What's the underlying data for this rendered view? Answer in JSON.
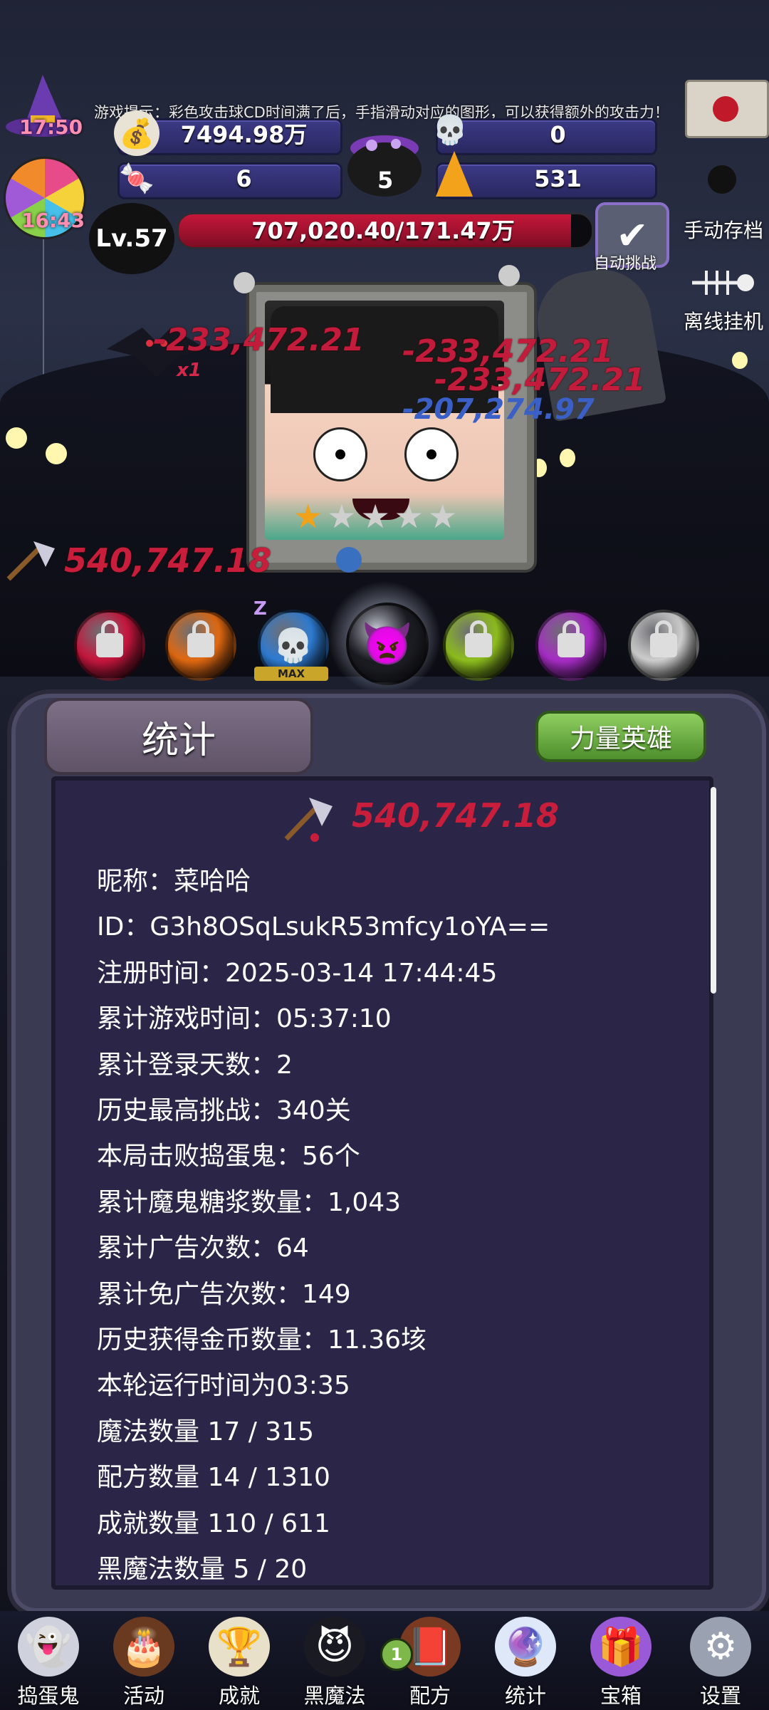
{
  "hud": {
    "hint": "游戏提示：彩色攻击球CD时间满了后，手指滑动对应的图形，可以获得额外的攻击力！",
    "timer1": "17:50",
    "timer2": "16:43",
    "gold": "7494.98万",
    "skull_res": "0",
    "candy_res": "6",
    "cauldron_count": "5",
    "corn_res": "531",
    "level": "Lv.57",
    "hp_text": "707,020.40/171.47万",
    "hp_fraction": 0.95,
    "auto_battle": "自动挑战",
    "manual_save": "手动存档",
    "offline_idle": "离线挂机"
  },
  "scene": {
    "dmg1": "-233,472.21",
    "dmg2": "-233,472.21",
    "dmg3": "-233,472.21",
    "dmg_blue": "-207,274.97",
    "attack_power": "540,747.18",
    "x1_label": "x1",
    "stars_filled": 1,
    "stars_total": 5,
    "sleep_z": "Z",
    "max_label": "MAX"
  },
  "orbs": [
    {
      "color": "#c8173e",
      "locked": true
    },
    {
      "color": "#e26a12",
      "locked": true
    },
    {
      "color": "#2f7dd4",
      "locked": false
    },
    {
      "color": "#1b1b22",
      "locked": false
    },
    {
      "color": "#8fbf1e",
      "locked": true
    },
    {
      "color": "#a82ec6",
      "locked": true
    },
    {
      "color": "#cfcfcf",
      "locked": true
    }
  ],
  "panel": {
    "title": "统计",
    "hero_button": "力量英雄",
    "power": "540,747.18",
    "stats": [
      "昵称：菜哈哈",
      "ID：G3h8OSqLsukR53mfcy1oYA==",
      "注册时间：2025-03-14 17:44:45",
      "累计游戏时间：05:37:10",
      "累计登录天数：2",
      "历史最高挑战：340关",
      "本局击败捣蛋鬼：56个",
      "累计魔鬼糖浆数量：1,043",
      "累计广告次数：64",
      "累计免广告次数：149",
      "历史获得金币数量：11.36垓",
      "本轮运行时间为03:35",
      "魔法数量 17 / 315",
      "配方数量 14 / 1310",
      "成就数量 110 / 611",
      "黑魔法数量 5 / 20"
    ]
  },
  "nav": [
    {
      "label": "捣蛋鬼",
      "icon": "ghost-icon"
    },
    {
      "label": "活动",
      "icon": "cake-icon"
    },
    {
      "label": "成就",
      "icon": "trophy-skull-icon"
    },
    {
      "label": "黑魔法",
      "icon": "demon-icon"
    },
    {
      "label": "配方",
      "icon": "book-icon",
      "badge": "1"
    },
    {
      "label": "统计",
      "icon": "crystal-ball-icon"
    },
    {
      "label": "宝箱",
      "icon": "gift-box-icon"
    },
    {
      "label": "设置",
      "icon": "gear-icon"
    }
  ]
}
